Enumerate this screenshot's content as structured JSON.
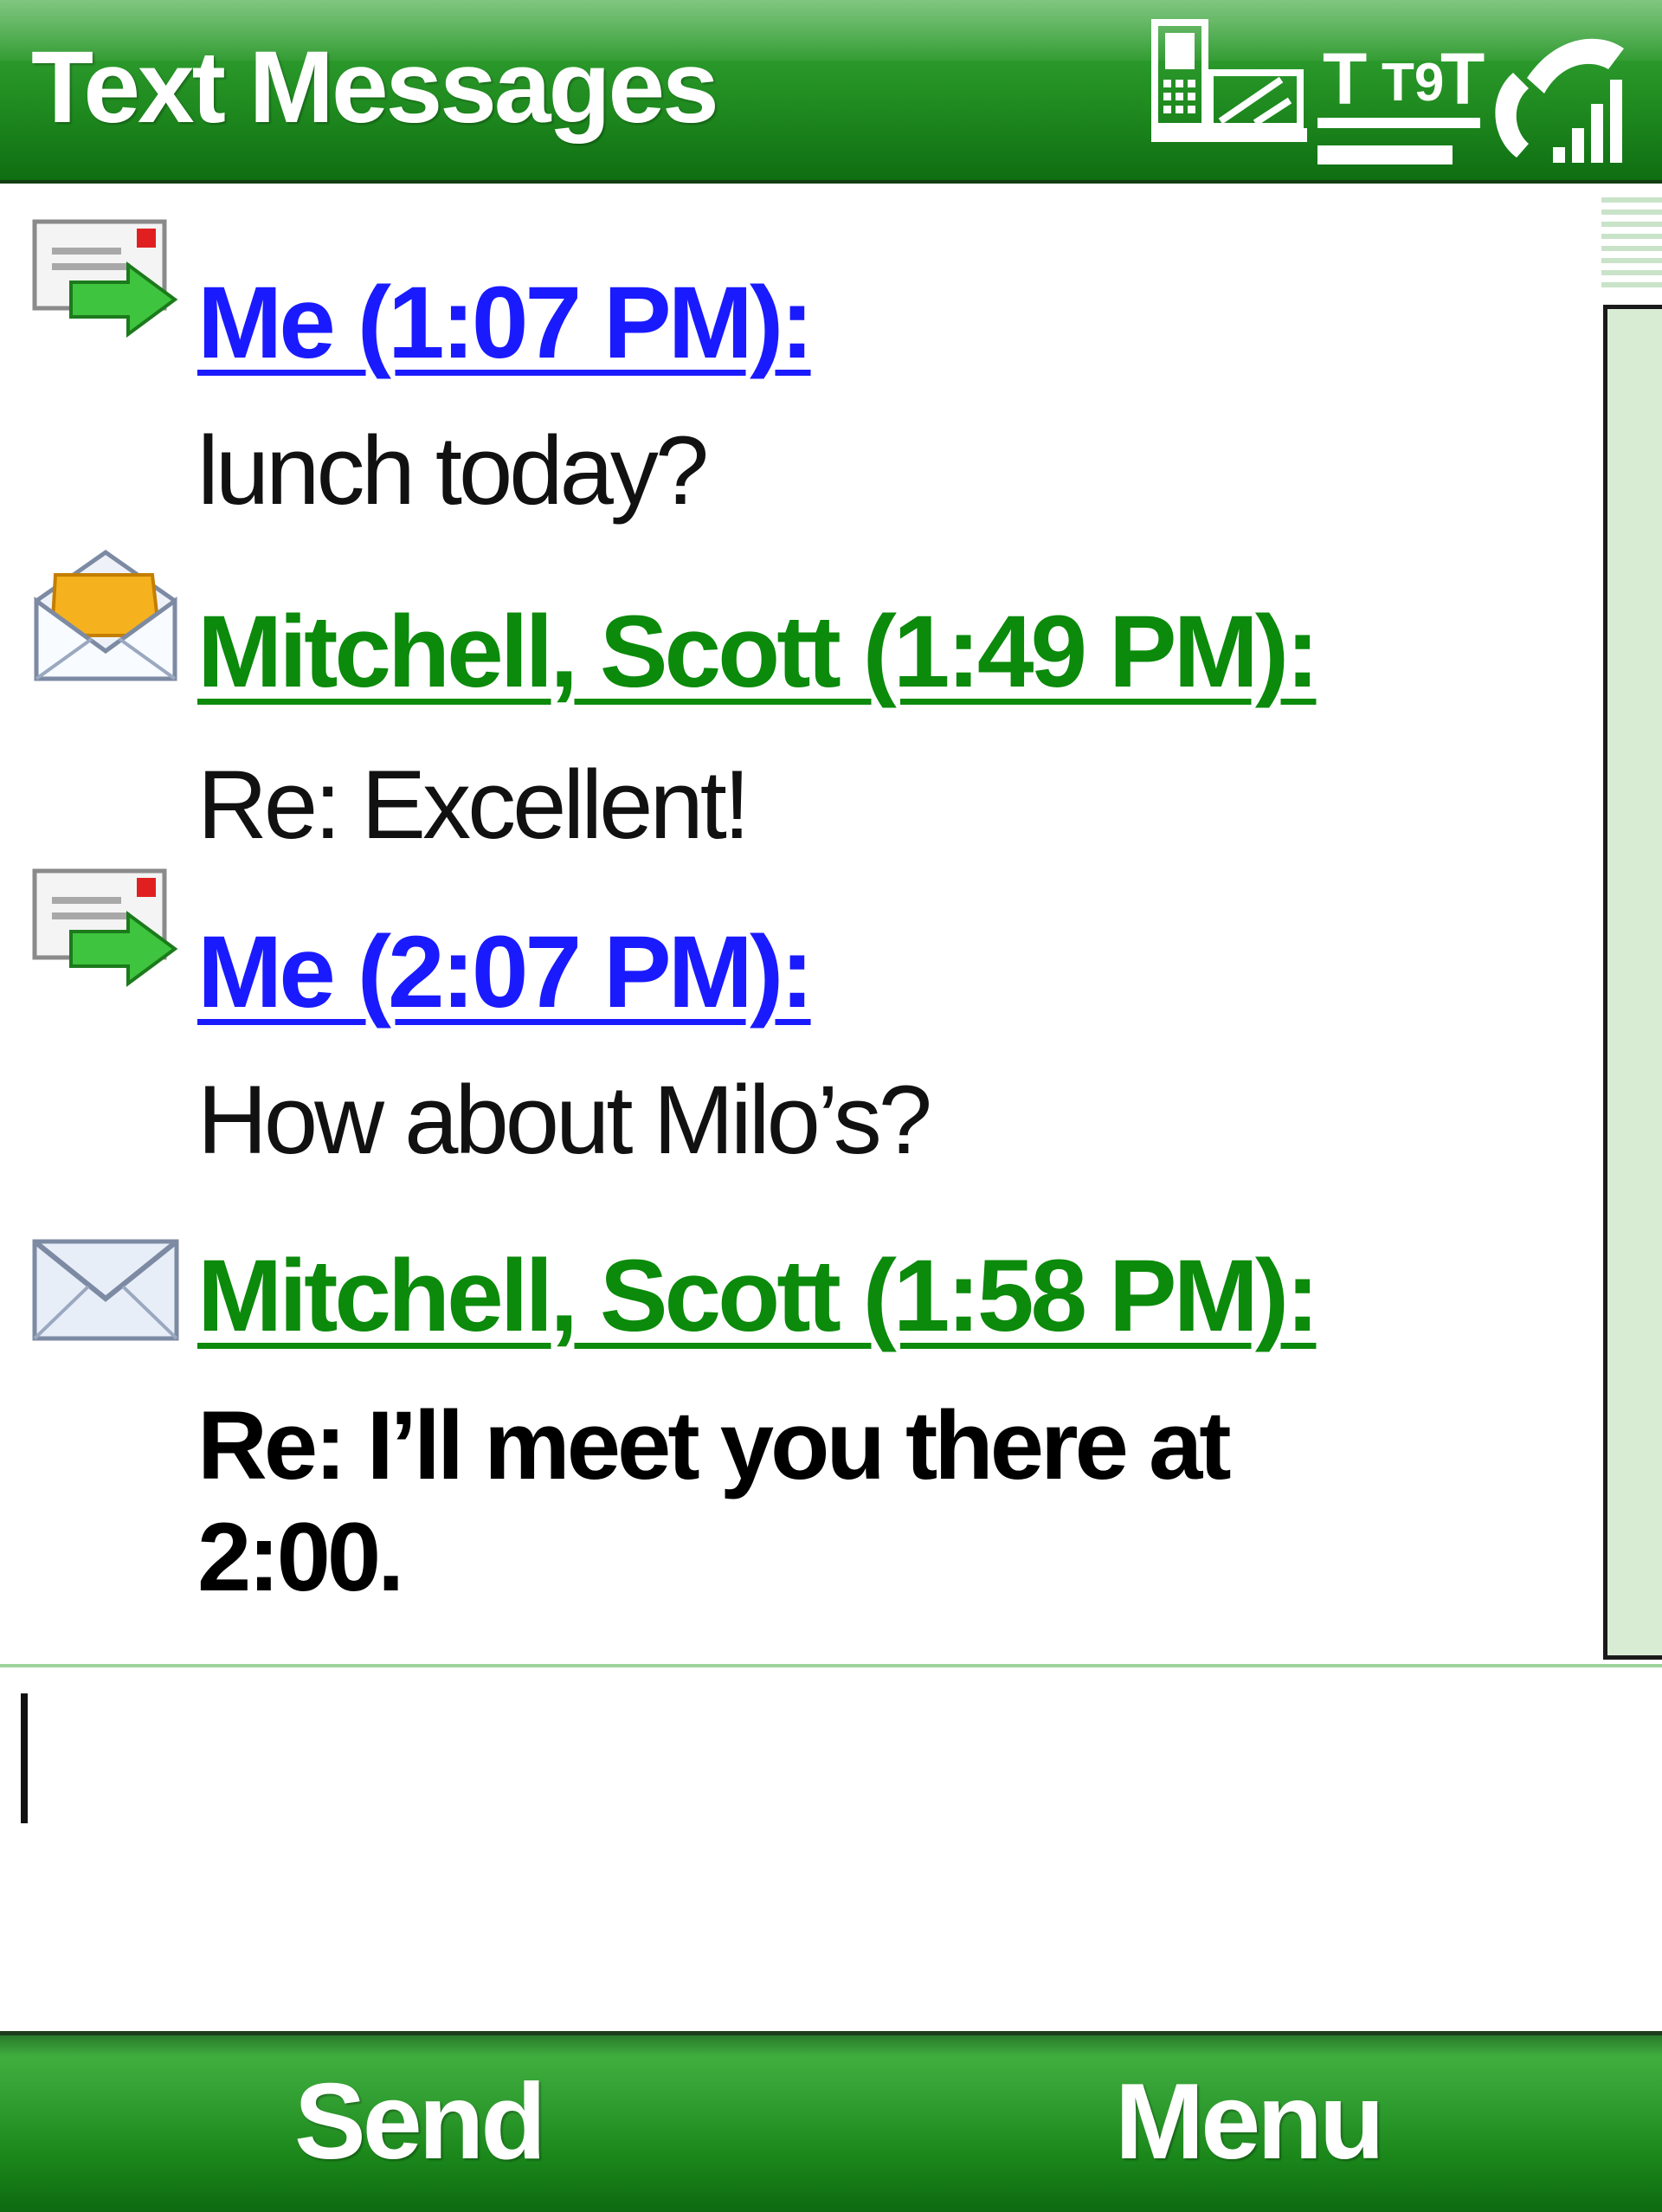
{
  "header": {
    "title": "Text Messages",
    "input_mode": "T9",
    "status_icons": [
      "device-keyboard-icon",
      "input-mode-t9-icon",
      "phone-signal-icon"
    ]
  },
  "messages": [
    {
      "header": "Me (1:07 PM):",
      "body": "lunch today?",
      "icon": "sent-message-icon",
      "sender_type": "me",
      "unread": false
    },
    {
      "header": "Mitchell, Scott (1:49 PM):",
      "body": "Re: Excellent!",
      "icon": "opened-envelope-icon",
      "sender_type": "other",
      "unread": false
    },
    {
      "header": "Me (2:07 PM):",
      "body": "How about Milo’s?",
      "icon": "sent-message-icon",
      "sender_type": "me",
      "unread": false
    },
    {
      "header": "Mitchell, Scott (1:58 PM):",
      "body": "Re:  I’ll meet you there at 2:00.",
      "icon": "closed-envelope-icon",
      "sender_type": "other",
      "unread": true
    }
  ],
  "compose": {
    "value": ""
  },
  "softkeys": {
    "left": "Send",
    "right": "Menu"
  },
  "colors": {
    "title_bar": "#1f8a1f",
    "me_link": "#1a1aff",
    "other_link": "#0b8a0b",
    "scrollbar": "#d8ecd4"
  }
}
